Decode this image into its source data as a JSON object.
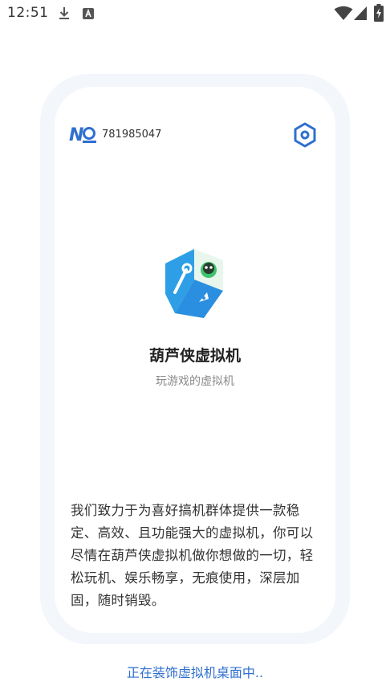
{
  "status_bar": {
    "time": "12:51",
    "icons": [
      "download-icon",
      "a-notification-icon",
      "wifi-icon",
      "signal-icon",
      "battery-charging-icon"
    ]
  },
  "card": {
    "device_label": "NO",
    "device_number": "781985047",
    "settings_icon": "settings-icon",
    "app_name": "葫芦侠虚拟机",
    "app_tagline": "玩游戏的虚拟机",
    "description": "我们致力于为喜好搞机群体提供一款稳定、高效、且功能强大的虚拟机，你可以尽情在葫芦侠虚拟机做你想做的一切，轻松玩机、娱乐畅享，无痕使用，深层加固，随时销毁。"
  },
  "loading": {
    "text": "正在装饰虚拟机桌面中.."
  },
  "colors": {
    "accent": "#2f6fcf",
    "logo_blue": "#2e9fe6",
    "logo_green": "#3cc46e",
    "card_border": "#f3f6fa"
  }
}
